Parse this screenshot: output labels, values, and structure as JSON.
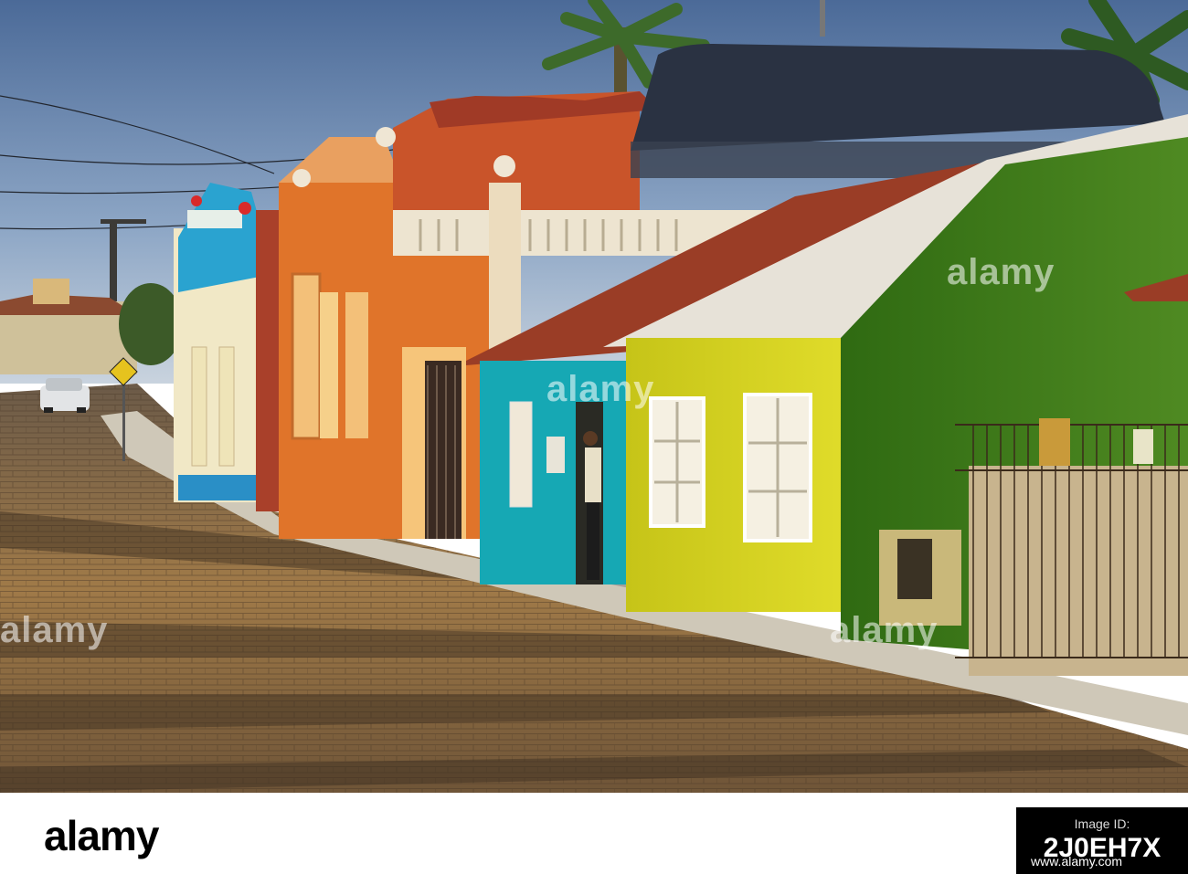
{
  "scene": {
    "description_alt": "",
    "colors": {
      "sky": "#6f8fb8",
      "pavement": "#8a6a40",
      "house_green": "#3f7a1e",
      "house_yellow": "#d2d21a",
      "house_turquoise": "#16a8b4",
      "house_orange": "#e0742a",
      "house_blue_white": "#2aa3d0",
      "roof_tile": "#9a3d26",
      "awning": "#2a3242"
    }
  },
  "watermarks": {
    "a": "alamy",
    "b": "alamy",
    "c": "alamy",
    "d": "alamy"
  },
  "footer": {
    "logo": "alamy",
    "id_label": "Image ID:",
    "image_id": "2J0EH7X",
    "url": "www.alamy.com"
  }
}
